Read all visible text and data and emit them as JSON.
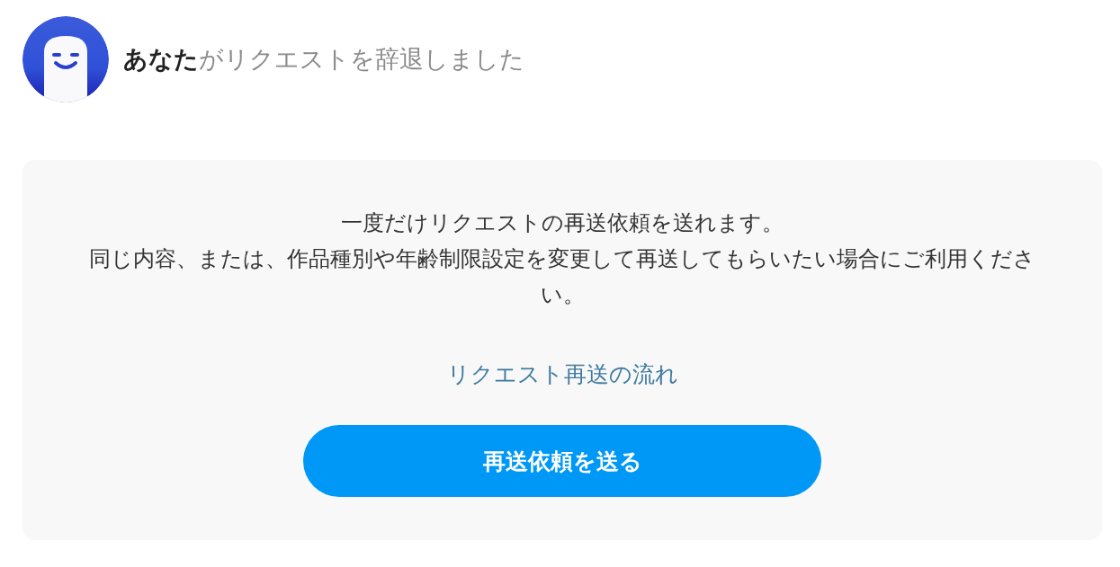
{
  "header": {
    "message": "**あなた**がリクエストを辞退しました"
  },
  "notice": {
    "paragraphs": [
      "一度だけリクエストの再送依頼を送れます。",
      "同じ内容、または、作品種別や年齢制限設定を変更して再送してもらいたい場合にご利用ください。"
    ],
    "link": "リクエスト再送の流れ",
    "button": "再送依頼を送る"
  }
}
